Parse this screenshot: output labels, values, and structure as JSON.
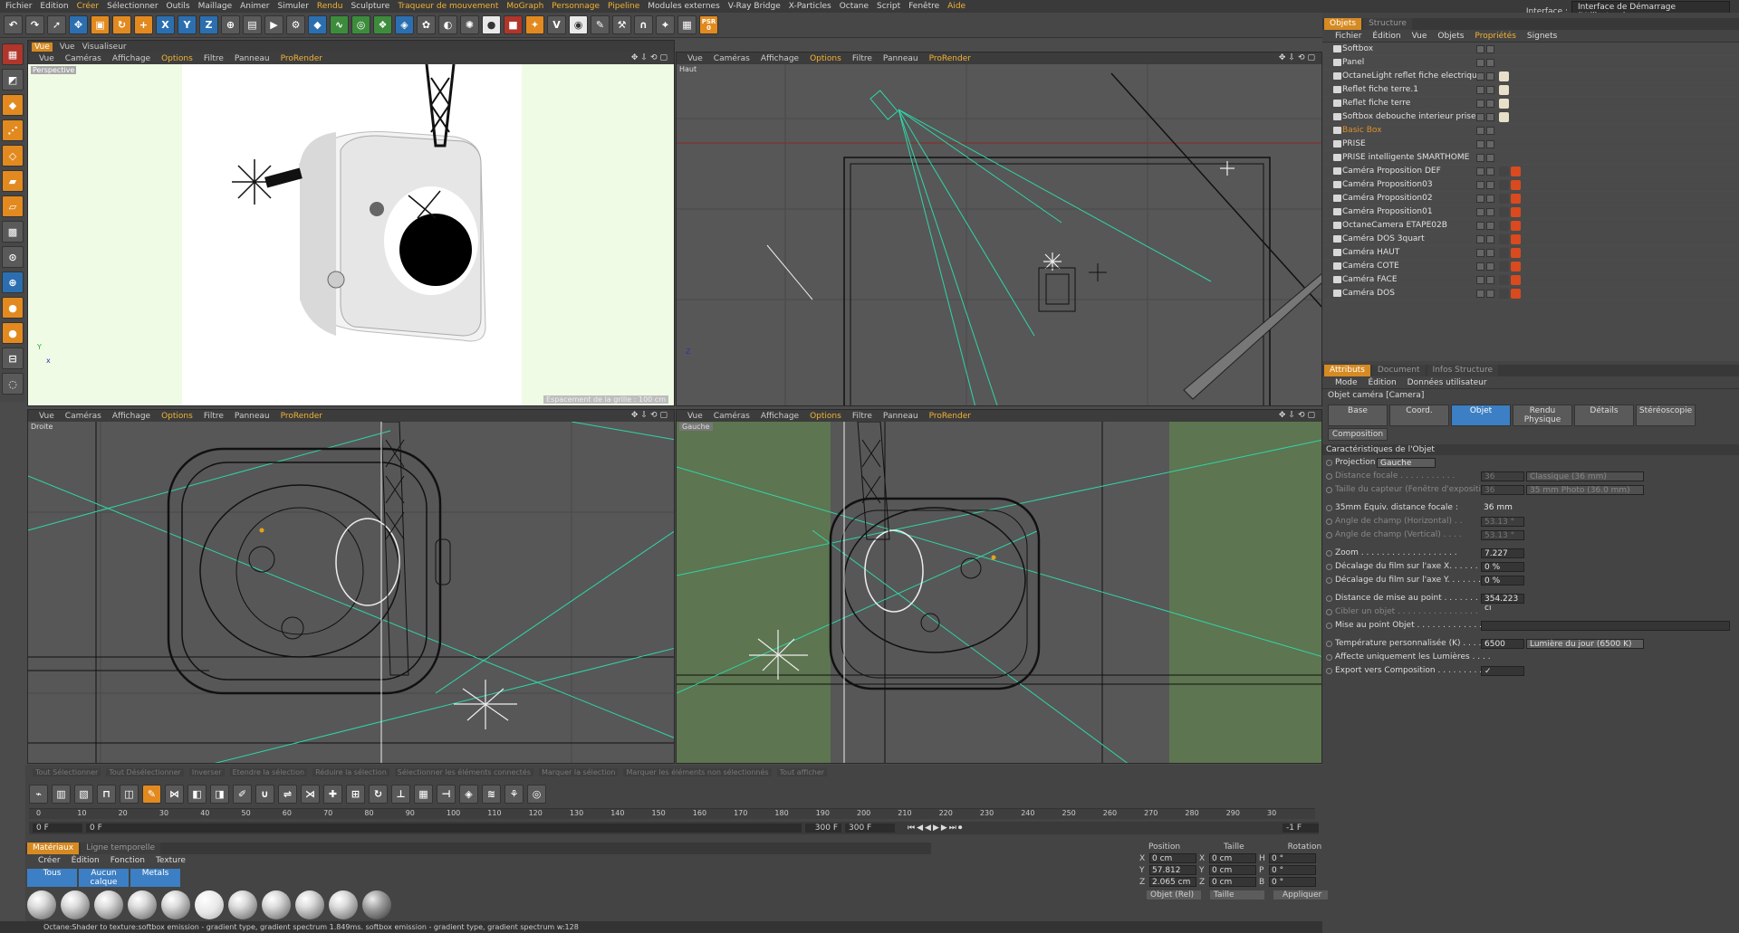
{
  "menubar": {
    "items": [
      "Fichier",
      "Edition",
      "Créer",
      "Sélectionner",
      "Outils",
      "Maillage",
      "Animer",
      "Simuler",
      "Rendu",
      "Sculpture",
      "Traqueur de mouvement",
      "MoGraph",
      "Personnage",
      "Pipeline",
      "Modules externes",
      "V-Ray Bridge",
      "X-Particles",
      "Octane",
      "Script",
      "Fenêtre",
      "Aide"
    ],
    "interface_label": "Interface :",
    "interface_value": "Interface de Démarrage (Utilisateur)"
  },
  "toolbar": {
    "psr_label": "PSR",
    "psr_value": "0"
  },
  "viewports": {
    "menu": [
      "Vue",
      "Caméras",
      "Affichage",
      "Options",
      "Filtre",
      "Panneau",
      "ProRender"
    ],
    "perspective": {
      "label": "Perspective",
      "tabs": [
        "Vue",
        "Vue",
        "Visualiseur"
      ],
      "grid_text": "Espacement de la grille : 100 cm"
    },
    "top": {
      "label": "Haut"
    },
    "right": {
      "label": "Droite"
    },
    "left": {
      "label": "Gauche"
    }
  },
  "objects_panel": {
    "tabs": [
      "Objets",
      "Structure"
    ],
    "menu": [
      "Fichier",
      "Édition",
      "Vue",
      "Objets",
      "Propriétés",
      "Signets"
    ],
    "items": [
      {
        "name": "Softbox",
        "style": "normal"
      },
      {
        "name": "Panel",
        "style": "normal"
      },
      {
        "name": "OctaneLight reflet fiche electrique",
        "style": "normal"
      },
      {
        "name": "Reflet fiche terre.1",
        "style": "normal"
      },
      {
        "name": "Reflet fiche terre",
        "style": "normal"
      },
      {
        "name": "Softbox debouche interieur prise",
        "style": "normal"
      },
      {
        "name": "Basic Box",
        "style": "orange"
      },
      {
        "name": "PRISE",
        "style": "normal"
      },
      {
        "name": "PRISE intelligente SMARTHOME",
        "style": "normal"
      },
      {
        "name": "Caméra Proposition DEF",
        "style": "normal"
      },
      {
        "name": "Caméra Proposition03",
        "style": "normal"
      },
      {
        "name": "Caméra Proposition02",
        "style": "normal"
      },
      {
        "name": "Caméra Proposition01",
        "style": "normal"
      },
      {
        "name": "OctaneCamera ETAPE02B",
        "style": "normal"
      },
      {
        "name": "Caméra DOS 3quart",
        "style": "normal"
      },
      {
        "name": "Caméra HAUT",
        "style": "normal"
      },
      {
        "name": "Caméra COTE",
        "style": "normal"
      },
      {
        "name": "Caméra FACE",
        "style": "normal"
      },
      {
        "name": "Caméra DOS",
        "style": "normal"
      }
    ]
  },
  "attributes_panel": {
    "tabs": [
      "Attributs",
      "Document",
      "Infos Structure"
    ],
    "menu": [
      "Mode",
      "Édition",
      "Données utilisateur"
    ],
    "object_title": "Objet caméra [Camera]",
    "sub_tabs": [
      "Base",
      "Coord.",
      "Objet",
      "Rendu Physique",
      "Détails",
      "Stéréoscopie",
      "Composition"
    ],
    "section_title": "Caractéristiques de l'Objet",
    "projection_label": "Projection",
    "projection_value": "Gauche",
    "fields": [
      {
        "label": "Distance focale . . . . . . . . . . .",
        "value": "36",
        "drop": "Classique (36 mm)",
        "dim": true
      },
      {
        "label": "Taille du capteur (Fenêtre d'exposition)",
        "value": "36",
        "drop": "35 mm Photo (36.0 mm)",
        "dim": true
      },
      {
        "label": "35mm Equiv. distance focale :",
        "value": "36 mm",
        "drop": "",
        "dim": false,
        "plain": true
      },
      {
        "label": "Angle de champ (Horizontal) . .",
        "value": "53.13 °",
        "drop": "",
        "dim": true
      },
      {
        "label": "Angle de champ (Vertical) . . . .",
        "value": "53.13 °",
        "drop": "",
        "dim": true
      },
      {
        "label": "Zoom . . . . . . . . . . . . . . . . . . .",
        "value": "7.227",
        "drop": "",
        "dim": false
      },
      {
        "label": "Décalage du film sur l'axe X. . . . . . . .",
        "value": "0 %",
        "drop": "",
        "dim": false
      },
      {
        "label": "Décalage du film sur l'axe Y. . . . . . . .",
        "value": "0 %",
        "drop": "",
        "dim": false
      },
      {
        "label": "Distance de mise au point . . . . . . . . .",
        "value": "354.223 cı",
        "drop": "",
        "dim": false
      },
      {
        "label": "Cibler un objet . . . . . . . . . . . . . . . .",
        "value": "",
        "drop": "",
        "dim": true
      },
      {
        "label": "Mise au point Objet . . . . . . . . . . . . .",
        "value": "",
        "drop": "",
        "dim": false,
        "wide": true
      },
      {
        "label": "Température personnalisée (K) . . . . .",
        "value": "6500",
        "drop": "Lumière du jour (6500 K)",
        "dim": false
      },
      {
        "label": "Affecte uniquement les Lumières . . . .",
        "value": "",
        "drop": "",
        "dim": false
      },
      {
        "label": "Export vers Composition . . . . . . . . .",
        "value": "✓",
        "drop": "",
        "dim": false
      }
    ]
  },
  "selection_bar": [
    "Tout Sélectionner",
    "Tout Désélectionner",
    "Inverser",
    "Etendre la sélection",
    "Réduire la sélection",
    "Sélectionner les éléments connectés",
    "Marquer la sélection",
    "Marquer les éléments non sélectionnés",
    "Tout afficher"
  ],
  "timeline": {
    "ticks": [
      "0",
      "10",
      "20",
      "30",
      "40",
      "50",
      "60",
      "70",
      "80",
      "90",
      "100",
      "110",
      "120",
      "130",
      "140",
      "150",
      "160",
      "170",
      "180",
      "190",
      "200",
      "210",
      "220",
      "230",
      "240",
      "250",
      "260",
      "270",
      "280",
      "290",
      "30"
    ],
    "current_frame": "-1 F",
    "start": "0 F",
    "mid": "0 F",
    "end_a": "300 F",
    "end_b": "300 F"
  },
  "materials": {
    "tabs": [
      "Matériaux",
      "Ligne temporelle"
    ],
    "menu": [
      "Créer",
      "Édition",
      "Fonction",
      "Texture"
    ],
    "filters": [
      "Tous",
      "Aucun calque",
      "Metals"
    ],
    "count": 11
  },
  "coordinates": {
    "headers": [
      "Position",
      "Taille",
      "Rotation"
    ],
    "rows": [
      {
        "axis": "X",
        "pos": "0 cm",
        "size_axis": "X",
        "size": "0 cm",
        "rot_axis": "H",
        "rot": "0 °"
      },
      {
        "axis": "Y",
        "pos": "57.812 cm",
        "size_axis": "Y",
        "size": "0 cm",
        "rot_axis": "P",
        "rot": "0 °"
      },
      {
        "axis": "Z",
        "pos": "2.065 cm",
        "size_axis": "Z",
        "size": "0 cm",
        "rot_axis": "B",
        "rot": "0 °"
      }
    ],
    "mode": "Objet (Rel)",
    "size_mode": "Taille",
    "apply": "Appliquer"
  },
  "status": "Octane:Shader to texture:softbox emission - gradient type, gradient spectrum  1.849ms.  softbox emission - gradient type, gradient spectrum w:128"
}
